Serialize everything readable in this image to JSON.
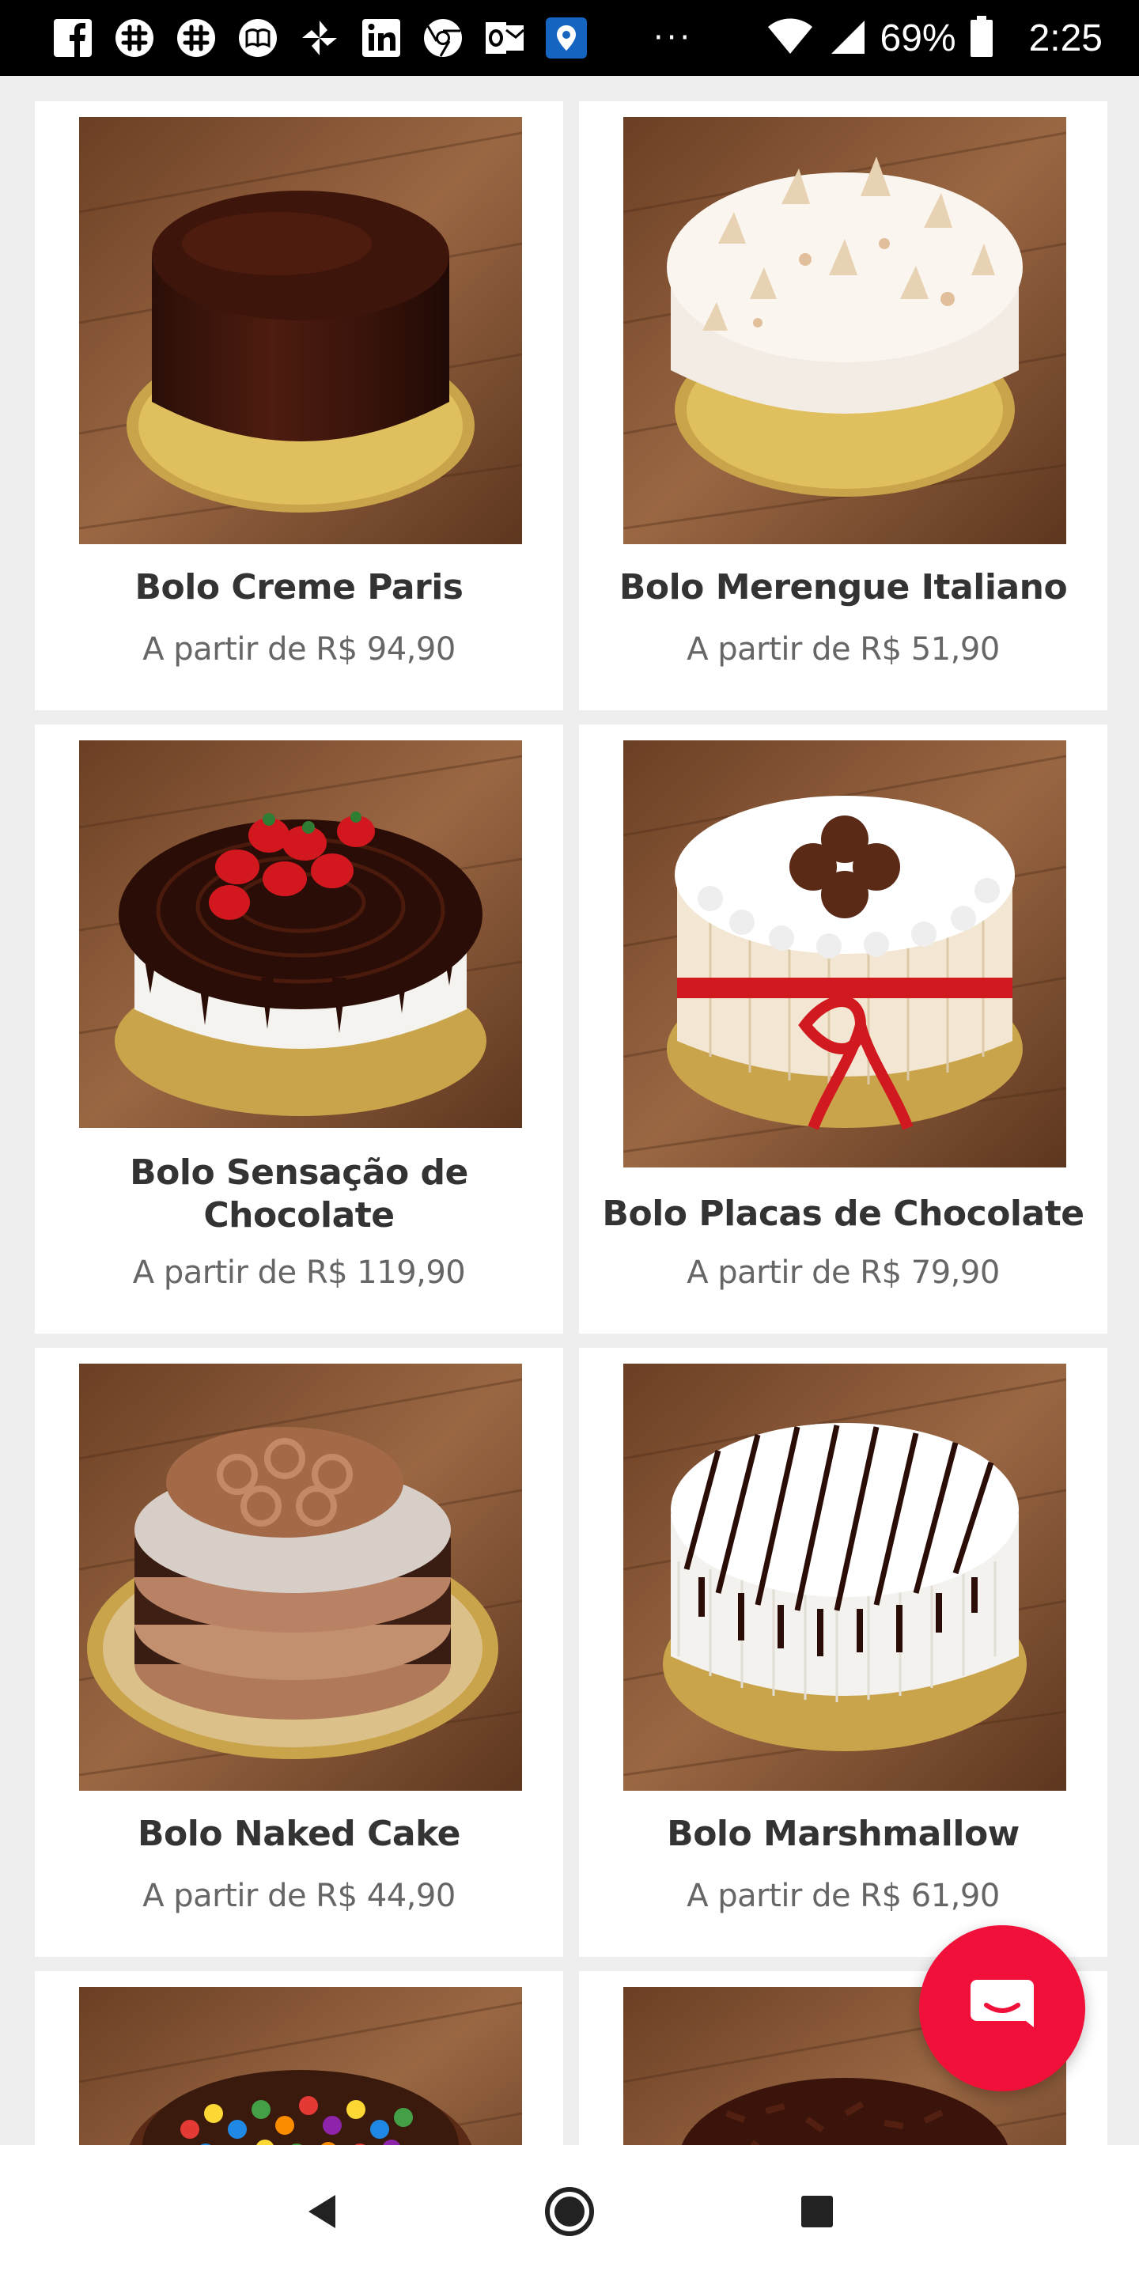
{
  "status_bar": {
    "battery": "69%",
    "time": "2:25",
    "overflow": "···",
    "notification_icons": [
      "facebook-icon",
      "slack-icon",
      "slack-icon",
      "reader-icon",
      "pinwheel-icon",
      "linkedin-icon",
      "chrome-icon",
      "outlook-icon",
      "maps-icon"
    ]
  },
  "products": [
    {
      "name": "Bolo Creme Paris",
      "price": "A partir de R$ 94,90",
      "image": "chocolate-glazed-cake"
    },
    {
      "name": "Bolo Merengue Italiano",
      "price": "A partir de R$ 51,90",
      "image": "meringue-cake"
    },
    {
      "name": "Bolo Sensação de Chocolate",
      "price": "A partir de R$ 119,90",
      "image": "chocolate-strawberry-cake"
    },
    {
      "name": "Bolo Placas de Chocolate",
      "price": "A partir de R$ 79,90",
      "image": "white-chocolate-ribbon-cake"
    },
    {
      "name": "Bolo Naked Cake",
      "price": "A partir de R$ 44,90",
      "image": "naked-cake"
    },
    {
      "name": "Bolo Marshmallow",
      "price": "A partir de R$ 61,90",
      "image": "marshmallow-cake"
    },
    {
      "name": "",
      "price": "",
      "image": "candy-cake"
    },
    {
      "name": "",
      "price": "",
      "image": "chocolate-shavings-cake"
    }
  ],
  "colors": {
    "fab": "#f0103a",
    "wood": "#8a5a3a",
    "background": "#eeeeee"
  },
  "navigation": {
    "buttons": [
      "back",
      "home",
      "recents"
    ]
  }
}
